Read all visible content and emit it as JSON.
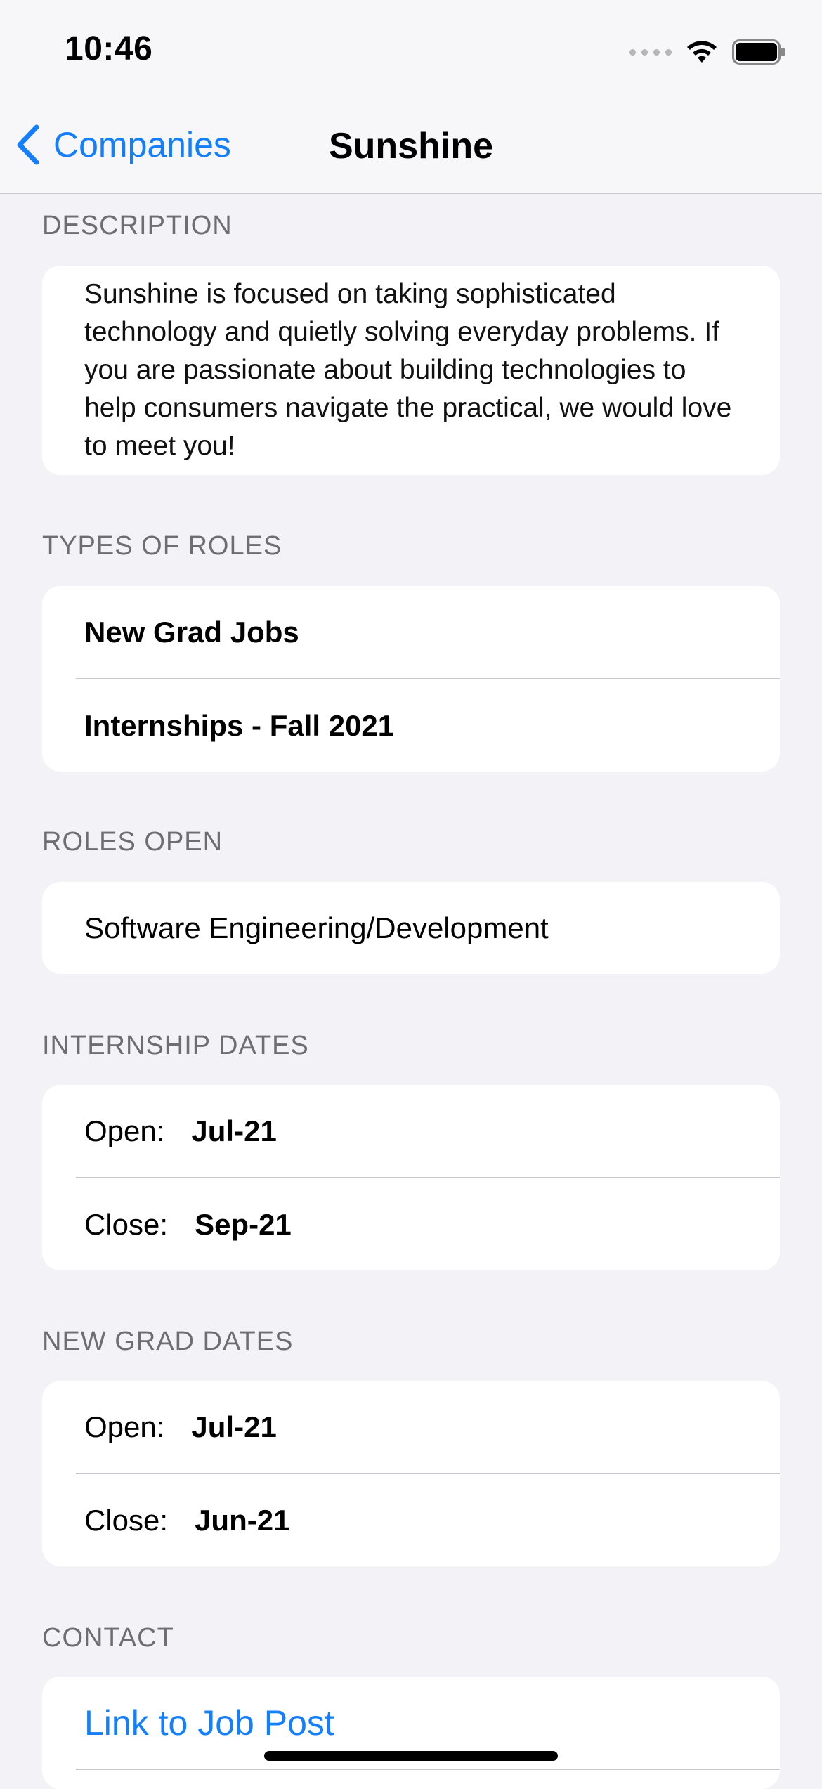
{
  "status_bar": {
    "time": "10:46"
  },
  "nav": {
    "back_label": "Companies",
    "title": "Sunshine"
  },
  "sections": {
    "description": {
      "header": "DESCRIPTION",
      "text": "Sunshine is focused on taking sophisticated technology and quietly solving everyday problems. If you are passionate about building technologies to help consumers navigate the practical, we would love to meet you!"
    },
    "types_of_roles": {
      "header": "TYPES OF ROLES",
      "items": [
        "New Grad Jobs",
        "Internships - Fall 2021"
      ]
    },
    "roles_open": {
      "header": "ROLES OPEN",
      "items": [
        "Software Engineering/Development"
      ]
    },
    "internship_dates": {
      "header": "INTERNSHIP DATES",
      "open_label": "Open:",
      "open_value": "Jul-21",
      "close_label": "Close:",
      "close_value": "Sep-21"
    },
    "new_grad_dates": {
      "header": "NEW GRAD DATES",
      "open_label": "Open:",
      "open_value": "Jul-21",
      "close_label": "Close:",
      "close_value": "Jun-21"
    },
    "contact": {
      "header": "CONTACT",
      "link_label": "Link to Job Post"
    }
  },
  "colors": {
    "accent": "#147efb",
    "background": "#f2f2f7",
    "header_text": "#6d6d72"
  }
}
